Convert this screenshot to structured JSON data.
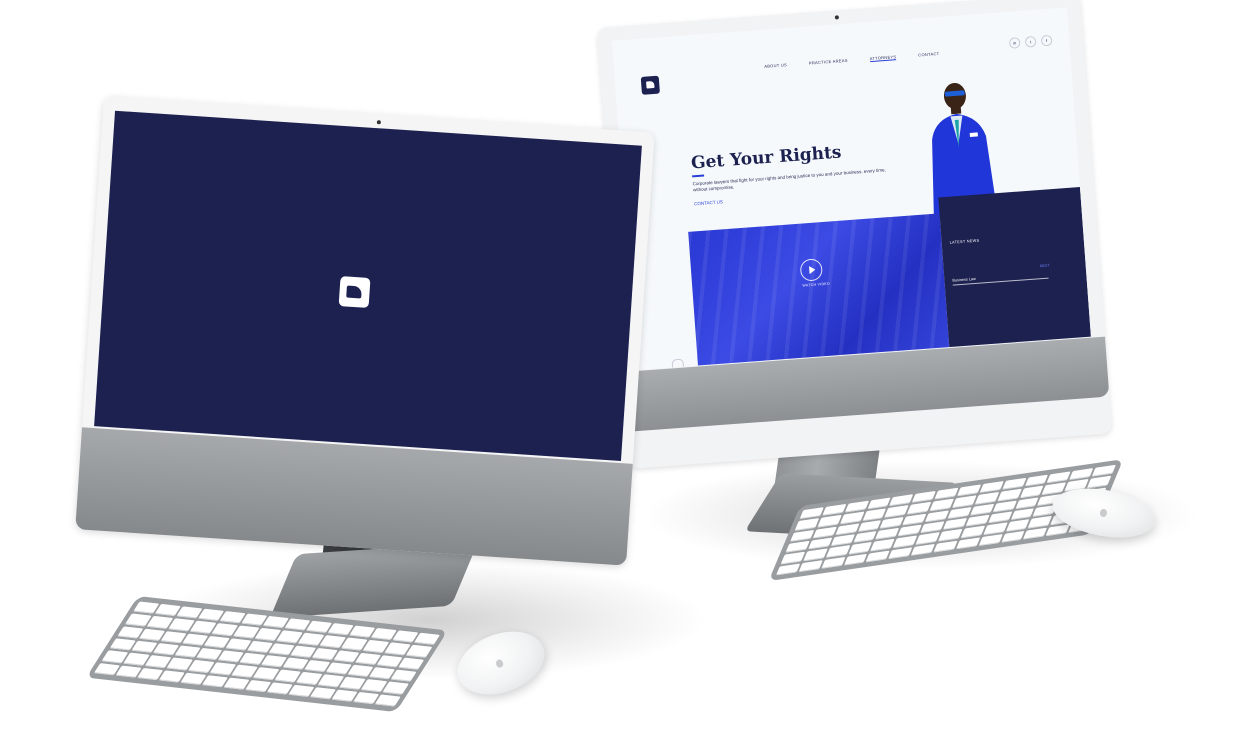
{
  "site": {
    "nav": [
      "ABOUT US",
      "PRACTICE AREAS",
      "ATTORNEYS",
      "CONTACT"
    ],
    "social": [
      "in",
      "t",
      "f"
    ],
    "hero_title": "Get Your Rights",
    "hero_text": "Corporate lawyers that fight for your rights and bring justice to you and your business, every time, without compromise.",
    "hero_link": "CONTACT US",
    "play_label": "WATCH VIDEO",
    "panel_label": "LATEST NEWS",
    "panel_sub": "Business Law",
    "panel_next": "NEXT"
  },
  "colors": {
    "navy": "#1c2150",
    "accent_blue": "#2b3fd6",
    "hero_bg": "#f6f9fc"
  },
  "icons": {
    "brand": "horse-head-logo",
    "play": "play-icon",
    "scroll": "scroll-mouse-icon"
  }
}
